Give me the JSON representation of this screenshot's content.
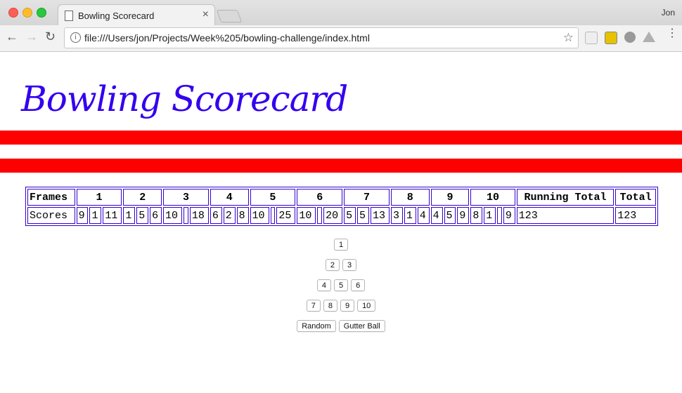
{
  "browser": {
    "tab_title": "Bowling Scorecard",
    "tab_close": "×",
    "profile_name": "Jon",
    "url": "file:///Users/jon/Projects/Week%205/bowling-challenge/index.html",
    "info_glyph": "i",
    "star_glyph": "☆",
    "back_glyph": "←",
    "forward_glyph": "→",
    "reload_glyph": "↻",
    "menu_glyph": "⋮"
  },
  "page": {
    "heading": "Bowling Scorecard",
    "stripe_color": "#ff0000",
    "heading_color": "#3300ee"
  },
  "scorecard": {
    "header_label": "Frames",
    "frame_numbers": [
      "1",
      "2",
      "3",
      "4",
      "5",
      "6",
      "7",
      "8",
      "9",
      "10"
    ],
    "running_total_label": "Running Total",
    "total_label": "Total",
    "row_label": "Scores",
    "frames": [
      [
        "9",
        "1",
        "11"
      ],
      [
        "1",
        "5",
        "6"
      ],
      [
        "10",
        "",
        "18"
      ],
      [
        "6",
        "2",
        "8"
      ],
      [
        "10",
        "",
        "25"
      ],
      [
        "10",
        "",
        "20"
      ],
      [
        "5",
        "5",
        "13"
      ],
      [
        "3",
        "1",
        "4"
      ],
      [
        "4",
        "5",
        "9"
      ],
      [
        "8",
        "1",
        "",
        "9"
      ]
    ],
    "running_total": "123",
    "total": "123"
  },
  "pins": {
    "row1": [
      "1"
    ],
    "row2": [
      "2",
      "3"
    ],
    "row3": [
      "4",
      "5",
      "6"
    ],
    "row4": [
      "7",
      "8",
      "9",
      "10"
    ],
    "random_label": "Random",
    "gutter_label": "Gutter Ball"
  }
}
